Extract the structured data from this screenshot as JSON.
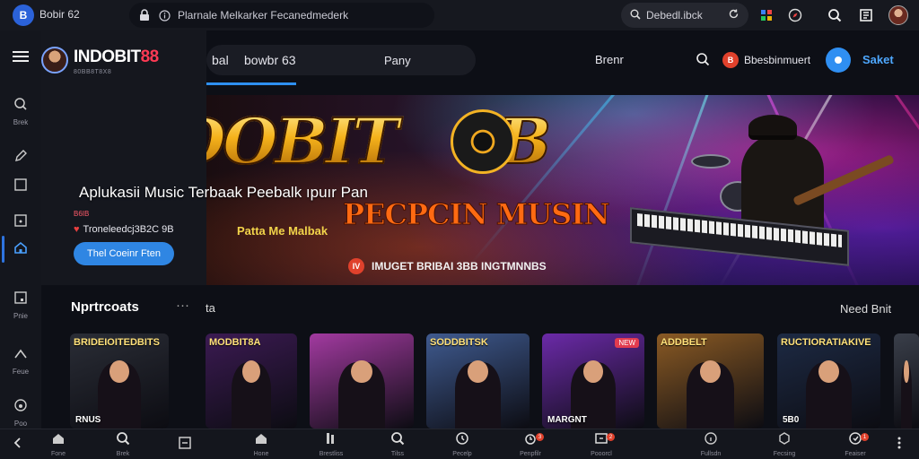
{
  "chrome": {
    "app_badge": "B",
    "app_title": "Bobir 62",
    "address": "Plarnale Melkarker Fecanedmederk",
    "search_value": "Debedl.ibck",
    "icons": [
      "info-icon",
      "shield-icon",
      "compass-icon",
      "search-icon",
      "reader-icon",
      "avatar"
    ]
  },
  "brand": {
    "name_prefix": "INDOBIT",
    "name_suffix": "88",
    "subtitle": "80BB8T8X8",
    "accent": "#ff3a54"
  },
  "topnav": {
    "items": [
      "bal",
      "bowbr 63",
      "Pany",
      "Brenr"
    ],
    "search_icon": "search-icon",
    "notice_badge": "B",
    "notice_label": "Bbesbinmuert",
    "user_label": "Saket"
  },
  "rail": {
    "items": [
      {
        "icon": "search-icon",
        "label": "Brek"
      },
      {
        "icon": "pencil-icon",
        "label": ""
      },
      {
        "icon": "square-icon",
        "label": ""
      },
      {
        "icon": "image-icon",
        "label": ""
      },
      {
        "icon": "home-icon",
        "label": ""
      },
      {
        "icon": "playlist-icon",
        "label": "Pnie"
      },
      {
        "icon": "chart-icon",
        "label": "Feue"
      },
      {
        "icon": "music-icon",
        "label": "Poo"
      }
    ]
  },
  "hero": {
    "logo": "INDOBIT",
    "logo_suffix": "8B",
    "subtitle": "PECPCIN MUSIN",
    "tagline": "Patta Me Malbak",
    "footer_badge": "IV",
    "footer": "IMUGET BRIBAI 3BB INGTMNNBS"
  },
  "promo": {
    "title": "Aplukasii Music Terbaak Peebalk ıpuır Pan",
    "mini": "B6IB",
    "line": "Troneleedcj3B2C 9B",
    "cta": "Thel Coeinr Ften"
  },
  "section": {
    "title": "Nprtrcoats",
    "more": "···",
    "title2": "ta",
    "see_all": "Need Bnit"
  },
  "cards": [
    {
      "title": "BRIDEIOITEDBITS",
      "caption": "RNUS",
      "badge": "",
      "bg": "#2a2d36"
    },
    {
      "title": "MODBIT8A",
      "caption": "",
      "badge": "",
      "bg": "#3b1a52"
    },
    {
      "title": "",
      "caption": "",
      "badge": "",
      "bg": "#a23aa0"
    },
    {
      "title": "SODDBITSK",
      "caption": "",
      "badge": "",
      "bg": "#3f5a8f"
    },
    {
      "title": "",
      "caption": "MARGNT",
      "badge": "NEW",
      "bg": "#6b2aa8"
    },
    {
      "title": "ADDBELT",
      "caption": "",
      "badge": "",
      "bg": "#8a5a24"
    },
    {
      "title": "RUCTIORATIAKIVE",
      "caption": "5B0",
      "badge": "",
      "bg": "#1d2a44"
    },
    {
      "title": "",
      "caption": "",
      "badge": "",
      "bg": "#3a3f4a"
    }
  ],
  "bottombar": {
    "items": [
      {
        "icon": "back-icon",
        "label": ""
      },
      {
        "icon": "home-icon",
        "label": "Fone"
      },
      {
        "icon": "search-icon",
        "label": "Brek"
      },
      {
        "icon": "minus-square-icon",
        "label": ""
      },
      {
        "icon": "home-icon",
        "label": "Hone"
      },
      {
        "icon": "library-icon",
        "label": "Brestliss"
      },
      {
        "icon": "search-icon",
        "label": "Tilss"
      },
      {
        "icon": "history-icon",
        "label": "Pecelp"
      },
      {
        "icon": "alarm-icon",
        "label": "Penpfilr",
        "notif": "3"
      },
      {
        "icon": "grid-icon",
        "label": "Pooorcl",
        "notif": "2"
      },
      {
        "icon": "info-icon",
        "label": "Fullsdn"
      },
      {
        "icon": "settings-icon",
        "label": "Fecsing"
      },
      {
        "icon": "refresh-icon",
        "label": "Feaiser",
        "notif": "1"
      },
      {
        "icon": "more-icon",
        "label": ""
      }
    ]
  }
}
